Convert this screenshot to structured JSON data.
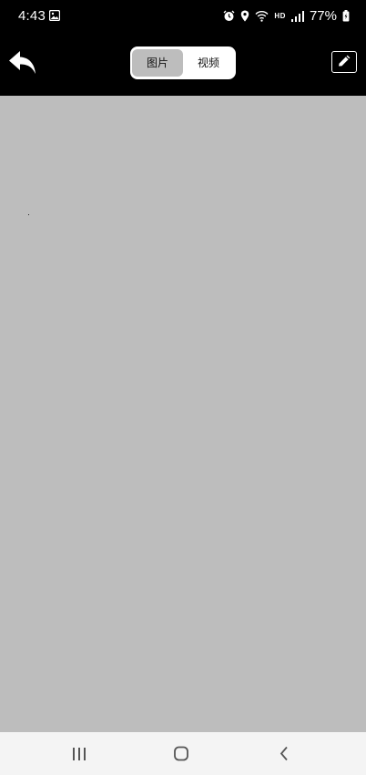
{
  "status_bar": {
    "time": "4:43",
    "network_label": "HD",
    "battery": "77%",
    "icons": [
      "image-icon",
      "alarm-icon",
      "location-icon",
      "wifi-icon",
      "signal-icon",
      "battery-icon"
    ]
  },
  "toolbar": {
    "tabs": [
      {
        "label": "图片",
        "active": true
      },
      {
        "label": "视频",
        "active": false
      }
    ],
    "icons": [
      "back-arrow-icon",
      "edit-icon"
    ]
  },
  "nav_bar": {
    "icons": [
      "recents-icon",
      "home-icon",
      "back-icon"
    ]
  }
}
